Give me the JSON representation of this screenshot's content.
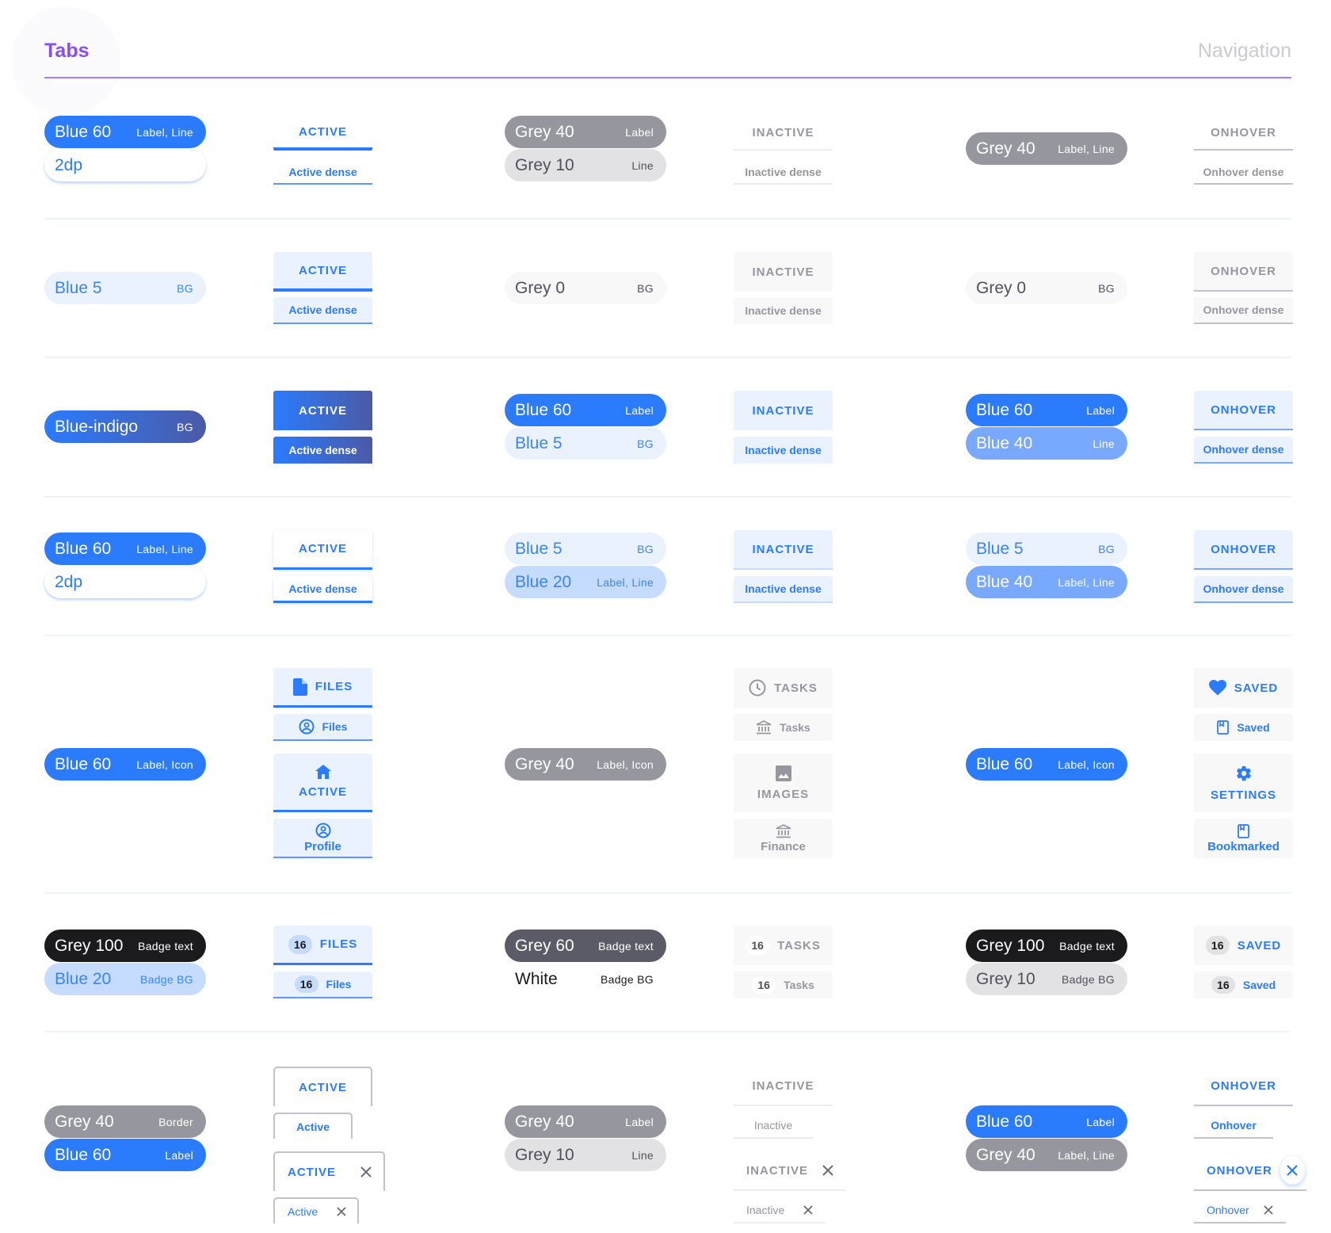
{
  "header": {
    "title": "Tabs",
    "section": "Navigation"
  },
  "colors": {
    "accent": "#8a4df5",
    "blue60": "#2b7bff",
    "blue40": "#79a9ff",
    "blue20": "#c6dcff",
    "blue5": "#eaf2ff",
    "grey100": "#1b1b1d",
    "grey60": "#5b5b68",
    "grey40": "#96969f",
    "grey10": "#e2e2e5",
    "grey0": "#f8f8f9",
    "white": "#ffffff"
  },
  "rows": [
    {
      "active_swatches": [
        {
          "name": "Blue 60",
          "role": "Label, Line"
        },
        {
          "name": "2dp",
          "role": ""
        }
      ],
      "active_tabs": {
        "big": "ACTIVE",
        "dense": "Active dense"
      },
      "inactive_swatches": [
        {
          "name": "Grey 40",
          "role": "Label"
        },
        {
          "name": "Grey 10",
          "role": "Line"
        }
      ],
      "inactive_tabs": {
        "big": "INACTIVE",
        "dense": "Inactive dense"
      },
      "hover_swatches": [
        {
          "name": "Grey 40",
          "role": "Label, Line"
        }
      ],
      "hover_tabs": {
        "big": "ONHOVER",
        "dense": "Onhover dense"
      }
    },
    {
      "active_swatches": [
        {
          "name": "Blue 5",
          "role": "BG"
        }
      ],
      "active_tabs": {
        "big": "ACTIVE",
        "dense": "Active dense"
      },
      "inactive_swatches": [
        {
          "name": "Grey 0",
          "role": "BG"
        }
      ],
      "inactive_tabs": {
        "big": "INACTIVE",
        "dense": "Inactive dense"
      },
      "hover_swatches": [
        {
          "name": "Grey 0",
          "role": "BG"
        }
      ],
      "hover_tabs": {
        "big": "ONHOVER",
        "dense": "Onhover dense"
      }
    },
    {
      "active_swatches": [
        {
          "name": "Blue-indigo",
          "role": "BG"
        }
      ],
      "active_tabs": {
        "big": "ACTIVE",
        "dense": "Active dense"
      },
      "inactive_swatches": [
        {
          "name": "Blue 60",
          "role": "Label"
        },
        {
          "name": "Blue 5",
          "role": "BG"
        }
      ],
      "inactive_tabs": {
        "big": "INACTIVE",
        "dense": "Inactive dense"
      },
      "hover_swatches": [
        {
          "name": "Blue 60",
          "role": "Label"
        },
        {
          "name": "Blue 40",
          "role": "Line"
        }
      ],
      "hover_tabs": {
        "big": "ONHOVER",
        "dense": "Onhover dense"
      }
    },
    {
      "active_swatches": [
        {
          "name": "Blue 60",
          "role": "Label, Line"
        },
        {
          "name": "2dp",
          "role": ""
        }
      ],
      "active_tabs": {
        "big": "ACTIVE",
        "dense": "Active dense"
      },
      "inactive_swatches": [
        {
          "name": "Blue 5",
          "role": "BG"
        },
        {
          "name": "Blue 20",
          "role": "Label, Line"
        }
      ],
      "inactive_tabs": {
        "big": "INACTIVE",
        "dense": "Inactive dense"
      },
      "hover_swatches": [
        {
          "name": "Blue 5",
          "role": "BG"
        },
        {
          "name": "Blue 40",
          "role": "Label, Line"
        }
      ],
      "hover_tabs": {
        "big": "ONHOVER",
        "dense": "Onhover dense"
      }
    },
    {
      "active_swatches": [
        {
          "name": "Blue 60",
          "role": "Label, Icon"
        }
      ],
      "active_tabs": {
        "big": "FILES",
        "big_icon": "file-icon",
        "dense": "Files",
        "dense_icon": "account-circle-icon",
        "tall": "ACTIVE",
        "tall_icon": "home-icon",
        "tall_dense": "Profile",
        "tall_dense_icon": "account-circle-icon"
      },
      "inactive_swatches": [
        {
          "name": "Grey 40",
          "role": "Label, Icon"
        }
      ],
      "inactive_tabs": {
        "big": "TASKS",
        "big_icon": "clock-icon",
        "dense": "Tasks",
        "dense_icon": "bank-icon",
        "tall": "IMAGES",
        "tall_icon": "image-icon",
        "tall_dense": "Finance",
        "tall_dense_icon": "bank-icon"
      },
      "hover_swatches": [
        {
          "name": "Blue 60",
          "role": "Label, Icon"
        }
      ],
      "hover_tabs": {
        "big": "SAVED",
        "big_icon": "heart-icon",
        "dense": "Saved",
        "dense_icon": "bookmark-icon",
        "tall": "SETTINGS",
        "tall_icon": "gear-icon",
        "tall_dense": "Bookmarked",
        "tall_dense_icon": "bookmark-icon"
      }
    },
    {
      "active_swatches": [
        {
          "name": "Grey 100",
          "role": "Badge text"
        },
        {
          "name": "Blue 20",
          "role": "Badge BG"
        }
      ],
      "active_tabs": {
        "badge": "16",
        "big": "FILES",
        "dense": "Files"
      },
      "inactive_swatches": [
        {
          "name": "Grey 60",
          "role": "Badge text"
        },
        {
          "name": "White",
          "role": "Badge BG"
        }
      ],
      "inactive_tabs": {
        "badge": "16",
        "big": "TASKS",
        "dense": "Tasks"
      },
      "hover_swatches": [
        {
          "name": "Grey 100",
          "role": "Badge text"
        },
        {
          "name": "Grey 10",
          "role": "Badge BG"
        }
      ],
      "hover_tabs": {
        "badge": "16",
        "big": "SAVED",
        "dense": "Saved"
      }
    },
    {
      "active_swatches": [
        {
          "name": "Grey 40",
          "role": "Border"
        },
        {
          "name": "Blue 60",
          "role": "Label"
        }
      ],
      "active_tabs": {
        "big": "ACTIVE",
        "dense": "Active",
        "big_closable": "ACTIVE",
        "dense_closable": "Active"
      },
      "inactive_swatches": [
        {
          "name": "Grey 40",
          "role": "Label"
        },
        {
          "name": "Grey 10",
          "role": "Line"
        }
      ],
      "inactive_tabs": {
        "big": "INACTIVE",
        "dense": "Inactive",
        "big_closable": "INACTIVE",
        "dense_closable": "Inactive"
      },
      "hover_swatches": [
        {
          "name": "Blue 60",
          "role": "Label"
        },
        {
          "name": "Grey 40",
          "role": "Label, Line"
        }
      ],
      "hover_tabs": {
        "big": "ONHOVER",
        "dense": "Onhover",
        "big_closable": "ONHOVER",
        "dense_closable": "Onhover"
      }
    }
  ]
}
